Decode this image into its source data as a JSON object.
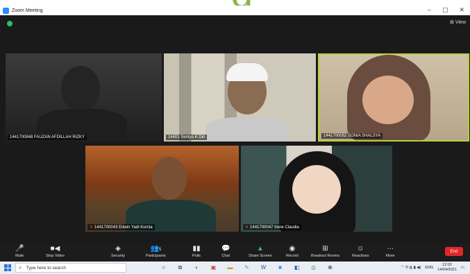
{
  "window": {
    "title": "Zoom Meeting"
  },
  "view": {
    "label": "View"
  },
  "participants": [
    {
      "name": "1441700848 FAUZAN AFDILLAH RIZKY"
    },
    {
      "name": "14401 Sentyo K Diri"
    },
    {
      "name": "1441700052 SONIA SHALSYA"
    },
    {
      "name": "1441700043 Edwin Yadi Kurnia"
    },
    {
      "name": "1441700047 Irene Claudia"
    }
  ],
  "toolbar": {
    "mute": "Mute",
    "stop_video": "Stop Video",
    "security": "Security",
    "participants": "Participants",
    "participants_count": "5",
    "polls": "Polls",
    "chat": "Chat",
    "share_screen": "Share Screen",
    "record": "Record",
    "breakout_rooms": "Breakout Rooms",
    "reactions": "Reactions",
    "more": "More",
    "end": "End"
  },
  "taskbar": {
    "search_placeholder": "Type here to search",
    "language": "ENG",
    "time": "12:02",
    "date": "14/04/2021"
  },
  "colors": {
    "accent": "#2d8cff",
    "end": "#e02828",
    "active_speaker": "#b8d337",
    "share": "#22c55e"
  }
}
